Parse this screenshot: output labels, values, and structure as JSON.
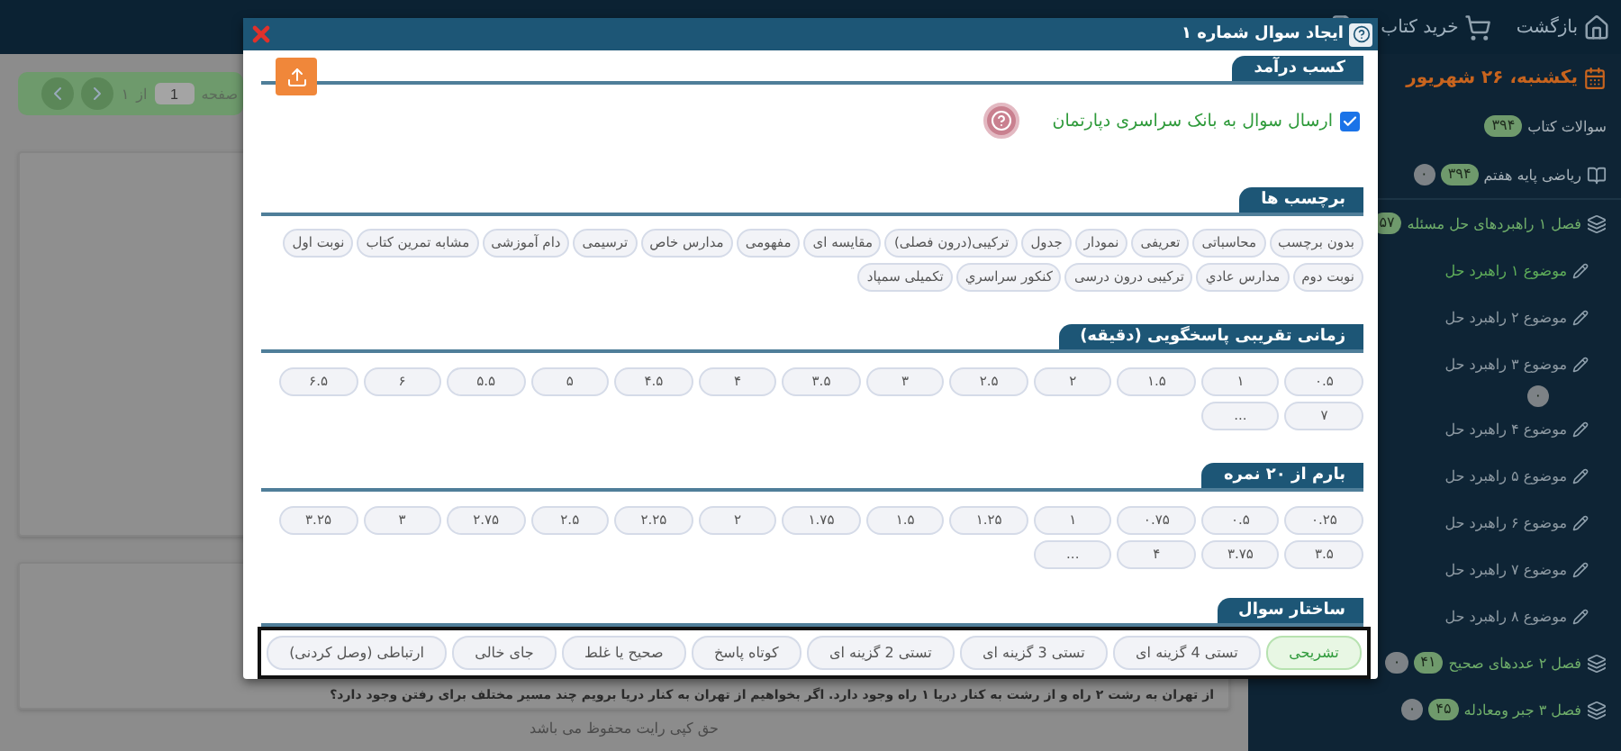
{
  "topbar": {
    "items": [
      {
        "kind": "home",
        "label": "بازگشت"
      },
      {
        "kind": "cart",
        "label": "خرید کتاب"
      }
    ]
  },
  "main": {
    "pager": {
      "label": "صفحه",
      "value": "1",
      "of": "از",
      "total": "۱"
    },
    "question": "از تهران به رشت ۲ راه و از رشت به کنار دریا ۱ راه وجود دارد. اگر بخواهیم از تهران به کنار دریا برویم چند مسیر مختلف برای رفتن وجود دارد؟",
    "footer": "حق کپی رایت محفوظ می باشد"
  },
  "sidebar": {
    "date": "یکشنبه، ۲۶ شهریور",
    "book_questions": {
      "label": "سوالات کتاب",
      "count": "۳۹۴"
    },
    "tree": [
      {
        "kind": "book",
        "label": "ریاضی پایه هفتم",
        "counts": [
          "۳۹۴",
          "۰"
        ],
        "children": [
          {
            "kind": "chapter",
            "label": "فصل ۱ راهبردهای حل مسئله",
            "counts": [
              "۵۷"
            ],
            "children": [
              {
                "kind": "topic",
                "label": "موضوع ۱ راهبرد حل",
                "selected": true
              },
              {
                "kind": "topic",
                "label": "موضوع ۲ راهبرد حل",
                "selected": false
              },
              {
                "kind": "topic",
                "label": "موضوع ۳ راهبرد حل",
                "selected": false,
                "counts": [
                  "۰"
                ]
              },
              {
                "kind": "topic",
                "label": "موضوع ۴ راهبرد حل",
                "selected": false
              },
              {
                "kind": "topic",
                "label": "موضوع ۵ راهبرد حل",
                "selected": false
              },
              {
                "kind": "topic",
                "label": "موضوع ۶ راهبرد حل",
                "selected": false
              },
              {
                "kind": "topic",
                "label": "موضوع ۷ راهبرد حل",
                "selected": false
              },
              {
                "kind": "topic",
                "label": "موضوع ۸ راهبرد حل",
                "selected": false
              }
            ]
          },
          {
            "kind": "chapter",
            "label": "فصل ۲ عددهای صحیح",
            "counts": [
              "۴۱",
              "۰"
            ]
          },
          {
            "kind": "chapter",
            "label": "فصل ۳ جبر ومعادله",
            "counts": [
              "۴۵",
              "۰"
            ]
          }
        ]
      }
    ]
  },
  "dialog": {
    "title": "ایجاد سوال شماره ۱",
    "sections": [
      {
        "kind": "checkbox",
        "title": "کسب درآمد",
        "label": "ارسال سوال به بانک سراسری دپارتمان",
        "checked": true
      },
      {
        "kind": "tags",
        "title": "برچسب ها",
        "options": [
          {
            "label": "بدون برچسب",
            "selected": false
          },
          {
            "label": "محاسباتی",
            "selected": false
          },
          {
            "label": "تعریفی",
            "selected": false
          },
          {
            "label": "نمودار",
            "selected": false
          },
          {
            "label": "جدول",
            "selected": false
          },
          {
            "label": "ترکیبی(درون فصلی)",
            "selected": false
          },
          {
            "label": "مقایسه ای",
            "selected": false
          },
          {
            "label": "مفهومی",
            "selected": false
          },
          {
            "label": "مدارس خاص",
            "selected": false
          },
          {
            "label": "ترسیمی",
            "selected": false
          },
          {
            "label": "دام آموزشی",
            "selected": false
          },
          {
            "label": "مشابه تمرین کتاب",
            "selected": false
          },
          {
            "label": "نوبت اول",
            "selected": false
          },
          {
            "label": "نوبت دوم",
            "selected": false
          },
          {
            "label": "مدارس عادي",
            "selected": false
          },
          {
            "label": "ترکیبی درون درسی",
            "selected": false
          },
          {
            "label": "کنکور سراسري",
            "selected": false
          },
          {
            "label": "تکمیلی سمپاد",
            "selected": false
          }
        ]
      },
      {
        "kind": "grid",
        "title": "زمانی تقریبی پاسخگویی (دقیقه)",
        "options": [
          {
            "label": "۰.۵",
            "selected": false
          },
          {
            "label": "۱",
            "selected": false
          },
          {
            "label": "۱.۵",
            "selected": false
          },
          {
            "label": "۲",
            "selected": false
          },
          {
            "label": "۲.۵",
            "selected": false
          },
          {
            "label": "۳",
            "selected": false
          },
          {
            "label": "۳.۵",
            "selected": false
          },
          {
            "label": "۴",
            "selected": false
          },
          {
            "label": "۴.۵",
            "selected": false
          },
          {
            "label": "۵",
            "selected": false
          },
          {
            "label": "۵.۵",
            "selected": false
          },
          {
            "label": "۶",
            "selected": false
          },
          {
            "label": "۶.۵",
            "selected": false
          },
          {
            "label": "۷",
            "selected": false
          },
          {
            "label": "...",
            "selected": false
          }
        ]
      },
      {
        "kind": "grid",
        "title": "بارم از ۲۰ نمره",
        "options": [
          {
            "label": "۰.۲۵",
            "selected": false
          },
          {
            "label": "۰.۵",
            "selected": false
          },
          {
            "label": "۰.۷۵",
            "selected": false
          },
          {
            "label": "۱",
            "selected": false
          },
          {
            "label": "۱.۲۵",
            "selected": false
          },
          {
            "label": "۱.۵",
            "selected": false
          },
          {
            "label": "۱.۷۵",
            "selected": false
          },
          {
            "label": "۲",
            "selected": false
          },
          {
            "label": "۲.۲۵",
            "selected": false
          },
          {
            "label": "۲.۵",
            "selected": false
          },
          {
            "label": "۲.۷۵",
            "selected": false
          },
          {
            "label": "۳",
            "selected": false
          },
          {
            "label": "۳.۲۵",
            "selected": false
          },
          {
            "label": "۳.۵",
            "selected": false
          },
          {
            "label": "۳.۷۵",
            "selected": false
          },
          {
            "label": "۴",
            "selected": false
          },
          {
            "label": "...",
            "selected": false
          }
        ]
      },
      {
        "kind": "choices",
        "title": "ساختار سوال",
        "options": [
          {
            "label": "تشریحی",
            "selected": true
          },
          {
            "label": "تستی 4 گزینه ای",
            "selected": false
          },
          {
            "label": "تستی 3 گزینه ای",
            "selected": false
          },
          {
            "label": "تستی 2 گزینه ای",
            "selected": false
          },
          {
            "label": "کوتاه پاسخ",
            "selected": false
          },
          {
            "label": "صحیح یا غلط",
            "selected": false
          },
          {
            "label": "جای خالی",
            "selected": false
          },
          {
            "label": "ارتباطی (وصل کردنی)",
            "selected": false
          }
        ]
      }
    ]
  }
}
